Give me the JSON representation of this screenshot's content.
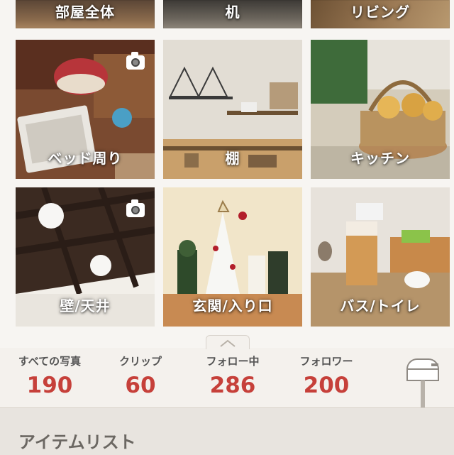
{
  "categories": [
    {
      "label": "部屋全体"
    },
    {
      "label": "机"
    },
    {
      "label": "リビング"
    },
    {
      "label": "ベッド周り"
    },
    {
      "label": "棚"
    },
    {
      "label": "キッチン"
    },
    {
      "label": "壁/天井"
    },
    {
      "label": "玄関/入り口"
    },
    {
      "label": "バス/トイレ"
    }
  ],
  "stats": {
    "photos": {
      "label": "すべての写真",
      "value": "190"
    },
    "clips": {
      "label": "クリップ",
      "value": "60"
    },
    "following": {
      "label": "フォロー中",
      "value": "286"
    },
    "followers": {
      "label": "フォロワー",
      "value": "200"
    }
  },
  "section": {
    "title": "アイテムリスト"
  },
  "icons": {
    "camera": "camera-icon",
    "mailbox": "mailbox-icon",
    "collapse": "chevron-up-icon"
  },
  "colors": {
    "accent": "#c6403a",
    "background": "#f4f1ed"
  }
}
